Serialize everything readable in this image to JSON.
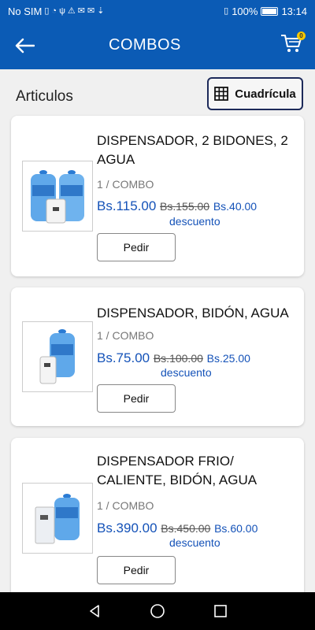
{
  "status_bar": {
    "carrier": "No SIM",
    "battery": "100%",
    "time": "13:14"
  },
  "app_bar": {
    "title": "COMBOS",
    "cart_count": "0"
  },
  "header": {
    "section_title": "Articulos",
    "view_toggle_label": "Cuadrícula"
  },
  "products": [
    {
      "name": "DISPENSADOR, 2 BIDONES, 2 AGUA",
      "unit": "1 / COMBO",
      "price": "Bs.115.00",
      "old_price": "Bs.155.00",
      "discount": "Bs.40.00",
      "discount_label": "descuento",
      "button": "Pedir"
    },
    {
      "name": "DISPENSADOR, BIDÓN, AGUA",
      "unit": "1 / COMBO",
      "price": "Bs.75.00",
      "old_price": "Bs.100.00",
      "discount": "Bs.25.00",
      "discount_label": "descuento",
      "button": "Pedir"
    },
    {
      "name": "DISPENSADOR FRIO/ CALIENTE, BIDÓN, AGUA",
      "unit": "1 / COMBO",
      "price": "Bs.390.00",
      "old_price": "Bs.450.00",
      "discount": "Bs.60.00",
      "discount_label": "descuento",
      "button": "Pedir"
    }
  ],
  "colors": {
    "primary": "#0b5bb5",
    "price": "#1452b8",
    "badge": "#f6c700"
  }
}
